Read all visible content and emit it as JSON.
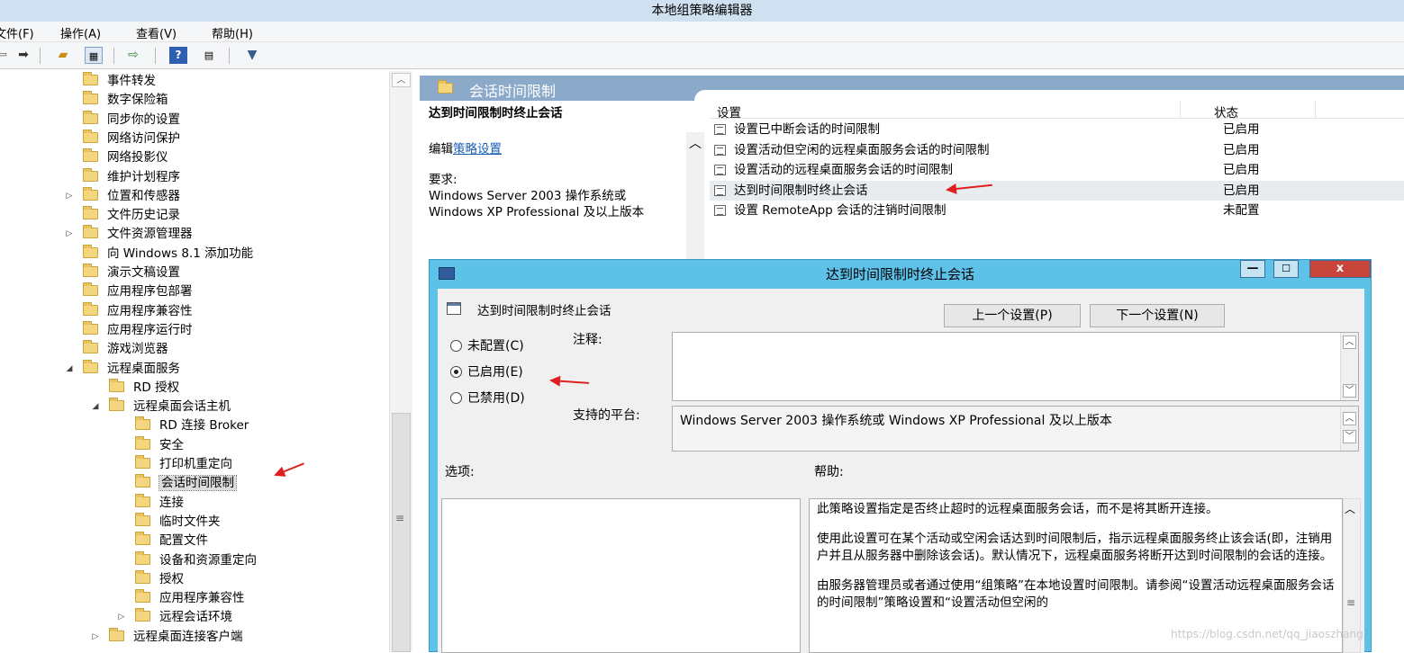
{
  "window": {
    "title": "本地组策略编辑器"
  },
  "menu": [
    "文件(F)",
    "操作(A)",
    "查看(V)",
    "帮助(H)"
  ],
  "toolbar": [
    "back-arrow-icon",
    "forward-arrow-icon",
    "up-folder-icon",
    "show-hide-tree-icon",
    "export-list-icon",
    "help-icon",
    "properties-icon",
    "filter-icon"
  ],
  "tree": {
    "items": [
      {
        "label": "事件转发",
        "indent": 0
      },
      {
        "label": "数字保险箱",
        "indent": 0
      },
      {
        "label": "同步你的设置",
        "indent": 0
      },
      {
        "label": "网络访问保护",
        "indent": 0
      },
      {
        "label": "网络投影仪",
        "indent": 0
      },
      {
        "label": "维护计划程序",
        "indent": 0
      },
      {
        "label": "位置和传感器",
        "indent": 0,
        "expander": "▷"
      },
      {
        "label": "文件历史记录",
        "indent": 0
      },
      {
        "label": "文件资源管理器",
        "indent": 0,
        "expander": "▷"
      },
      {
        "label": "向 Windows 8.1 添加功能",
        "indent": 0
      },
      {
        "label": "演示文稿设置",
        "indent": 0
      },
      {
        "label": "应用程序包部署",
        "indent": 0
      },
      {
        "label": "应用程序兼容性",
        "indent": 0
      },
      {
        "label": "应用程序运行时",
        "indent": 0
      },
      {
        "label": "游戏浏览器",
        "indent": 0
      },
      {
        "label": "远程桌面服务",
        "indent": 0,
        "expander": "◢"
      },
      {
        "label": "RD 授权",
        "indent": 1
      },
      {
        "label": "远程桌面会话主机",
        "indent": 1,
        "expander": "◢"
      },
      {
        "label": "RD 连接 Broker",
        "indent": 2
      },
      {
        "label": "安全",
        "indent": 2
      },
      {
        "label": "打印机重定向",
        "indent": 2
      },
      {
        "label": "会话时间限制",
        "indent": 2,
        "selected": true
      },
      {
        "label": "连接",
        "indent": 2
      },
      {
        "label": "临时文件夹",
        "indent": 2
      },
      {
        "label": "配置文件",
        "indent": 2
      },
      {
        "label": "设备和资源重定向",
        "indent": 2
      },
      {
        "label": "授权",
        "indent": 2
      },
      {
        "label": "应用程序兼容性",
        "indent": 2
      },
      {
        "label": "远程会话环境",
        "indent": 2,
        "expander": "▷"
      },
      {
        "label": "远程桌面连接客户端",
        "indent": 1,
        "expander": "▷"
      }
    ]
  },
  "right": {
    "header": "会话时间限制",
    "desc": {
      "title": "达到时间限制时终止会话",
      "edit_prefix": "编辑",
      "edit_link": "策略设置",
      "req_label": "要求:",
      "req_text": "Windows Server 2003 操作系统或 Windows XP Professional 及以上版本"
    },
    "columns": {
      "setting": "设置",
      "state": "状态"
    },
    "rows": [
      {
        "name": "设置已中断会话的时间限制",
        "state": "已启用"
      },
      {
        "name": "设置活动但空闲的远程桌面服务会话的时间限制",
        "state": "已启用"
      },
      {
        "name": "设置活动的远程桌面服务会话的时间限制",
        "state": "已启用"
      },
      {
        "name": "达到时间限制时终止会话",
        "state": "已启用",
        "highlight": true
      },
      {
        "name": "设置 RemoteApp 会话的注销时间限制",
        "state": "未配置"
      }
    ]
  },
  "dialog": {
    "title": "达到时间限制时终止会话",
    "setting_name": "达到时间限制时终止会话",
    "prev_button": "上一个设置(P)",
    "next_button": "下一个设置(N)",
    "radios": [
      {
        "label": "未配置(C)",
        "checked": false
      },
      {
        "label": "已启用(E)",
        "checked": true
      },
      {
        "label": "已禁用(D)",
        "checked": false
      }
    ],
    "comment_label": "注释:",
    "comment_value": "",
    "platform_label": "支持的平台:",
    "platform_value": "Windows Server 2003 操作系统或 Windows XP Professional 及以上版本",
    "options_label": "选项:",
    "help_label": "帮助:",
    "help_paragraphs": [
      "此策略设置指定是否终止超时的远程桌面服务会话，而不是将其断开连接。",
      "使用此设置可在某个活动或空闲会话达到时间限制后，指示远程桌面服务终止该会话(即，注销用户并且从服务器中删除该会话)。默认情况下，远程桌面服务将断开达到时间限制的会话的连接。",
      "由服务器管理员或者通过使用“组策略”在本地设置时间限制。请参阅“设置活动远程桌面服务会话的时间限制”策略设置和“设置活动但空闲的"
    ]
  },
  "watermark": "https://blog.csdn.net/qq_jiaoszhang"
}
